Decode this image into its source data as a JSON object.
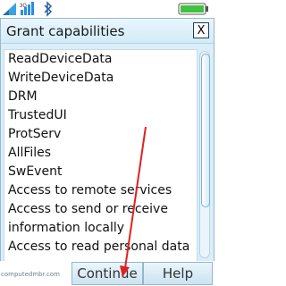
{
  "status_bar": {
    "icons": [
      "signal-strength-icon",
      "3g-network-icon",
      "bluetooth-icon",
      "battery-icon"
    ],
    "signal_label": "3G"
  },
  "dialog": {
    "title": "Grant capabilities",
    "close_label": "X",
    "capabilities": [
      "ReadDeviceData",
      "WriteDeviceData",
      "DRM",
      "TrustedUI",
      "ProtServ",
      "AllFiles",
      "SwEvent",
      "Access to remote services",
      "Access to send or receive",
      "information locally",
      "Access to read personal data"
    ]
  },
  "softkeys": {
    "left_label": "",
    "middle_label": "Continue",
    "right_label": "Help"
  },
  "watermark": "computedmbr.com",
  "colors": {
    "dialog_bg": "#d9eef9",
    "annotation_arrow": "#e02020"
  }
}
